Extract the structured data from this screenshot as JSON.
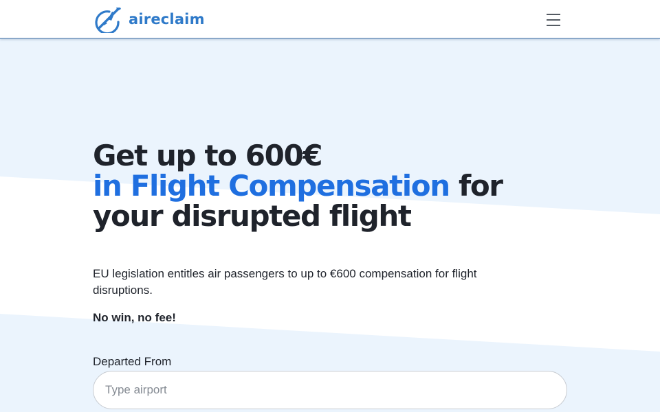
{
  "header": {
    "logo_text": "aireclaim",
    "logo_icon": "airplane-globe-icon",
    "menu_icon": "hamburger-menu-icon"
  },
  "hero": {
    "headline_line1": "Get up to 600€",
    "headline_accent": "in Flight Compensation",
    "headline_rest": " for your disrupted flight",
    "description": "EU legislation entitles air passengers to up to €600 compensation for flight disruptions.",
    "tagline": "No win, no fee!"
  },
  "form": {
    "departed_label": "Departed From",
    "departed_placeholder": "Type airport"
  },
  "colors": {
    "brand": "#2f7ac9",
    "accent": "#1f6fe0",
    "hero_background": "#ebf4fd",
    "text": "#1f232b"
  }
}
